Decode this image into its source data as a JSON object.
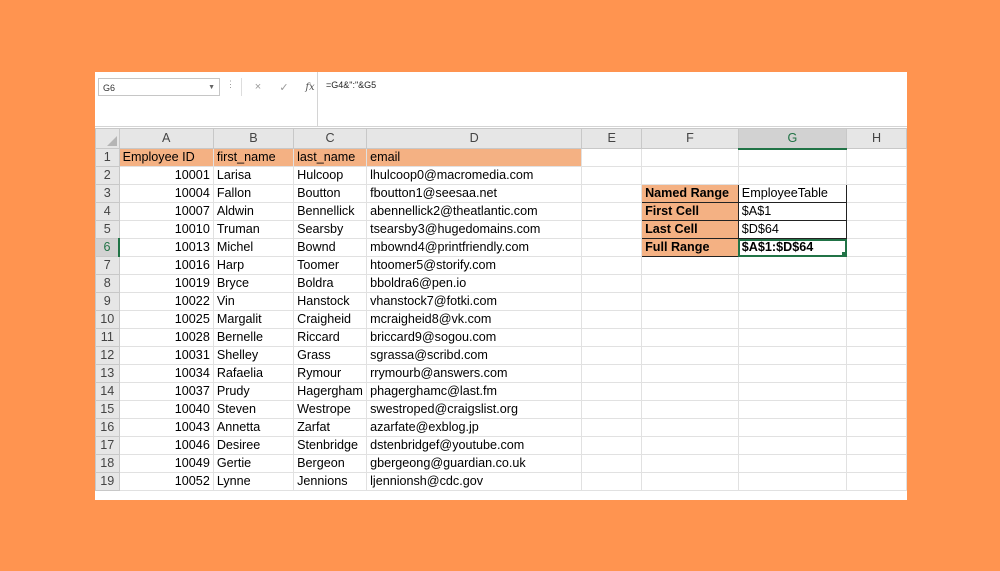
{
  "formula_bar": {
    "name_box": "G6",
    "cancel_icon": "×",
    "enter_icon": "✓",
    "fx_label": "fx",
    "formula": "=G4&\":\"&G5"
  },
  "columns": [
    "A",
    "B",
    "C",
    "D",
    "E",
    "F",
    "G",
    "H"
  ],
  "headers": [
    "Employee ID",
    "first_name",
    "last_name",
    "email"
  ],
  "rows": [
    {
      "n": "1"
    },
    {
      "n": "2",
      "id": "10001",
      "first": "Larisa",
      "last": "Hulcoop",
      "email": "lhulcoop0@macromedia.com"
    },
    {
      "n": "3",
      "id": "10004",
      "first": "Fallon",
      "last": "Boutton",
      "email": "fboutton1@seesaa.net"
    },
    {
      "n": "4",
      "id": "10007",
      "first": "Aldwin",
      "last": "Bennellick",
      "email": "abennellick2@theatlantic.com"
    },
    {
      "n": "5",
      "id": "10010",
      "first": "Truman",
      "last": "Searsby",
      "email": "tsearsby3@hugedomains.com"
    },
    {
      "n": "6",
      "id": "10013",
      "first": "Michel",
      "last": "Bownd",
      "email": "mbownd4@printfriendly.com"
    },
    {
      "n": "7",
      "id": "10016",
      "first": "Harp",
      "last": "Toomer",
      "email": "htoomer5@storify.com"
    },
    {
      "n": "8",
      "id": "10019",
      "first": "Bryce",
      "last": "Boldra",
      "email": "bboldra6@pen.io"
    },
    {
      "n": "9",
      "id": "10022",
      "first": "Vin",
      "last": "Hanstock",
      "email": "vhanstock7@fotki.com"
    },
    {
      "n": "10",
      "id": "10025",
      "first": "Margalit",
      "last": "Craigheid",
      "email": "mcraigheid8@vk.com"
    },
    {
      "n": "11",
      "id": "10028",
      "first": "Bernelle",
      "last": "Riccard",
      "email": "briccard9@sogou.com"
    },
    {
      "n": "12",
      "id": "10031",
      "first": "Shelley",
      "last": "Grass",
      "email": "sgrassa@scribd.com"
    },
    {
      "n": "13",
      "id": "10034",
      "first": "Rafaelia",
      "last": "Rymour",
      "email": "rrymourb@answers.com"
    },
    {
      "n": "14",
      "id": "10037",
      "first": "Prudy",
      "last": "Hagergham",
      "email": "phagerghamc@last.fm"
    },
    {
      "n": "15",
      "id": "10040",
      "first": "Steven",
      "last": "Westrope",
      "email": "swestroped@craigslist.org"
    },
    {
      "n": "16",
      "id": "10043",
      "first": "Annetta",
      "last": "Zarfat",
      "email": "azarfate@exblog.jp"
    },
    {
      "n": "17",
      "id": "10046",
      "first": "Desiree",
      "last": "Stenbridge",
      "email": "dstenbridgef@youtube.com"
    },
    {
      "n": "18",
      "id": "10049",
      "first": "Gertie",
      "last": "Bergeon",
      "email": "gbergeong@guardian.co.uk"
    },
    {
      "n": "19",
      "id": "10052",
      "first": "Lynne",
      "last": "Jennions",
      "email": "ljennionsh@cdc.gov"
    }
  ],
  "side_table": {
    "named_range_label": "Named Range",
    "named_range_value": "EmployeeTable",
    "first_cell_label": "First Cell",
    "first_cell_value": "$A$1",
    "last_cell_label": "Last Cell",
    "last_cell_value": "$D$64",
    "full_range_label": "Full Range",
    "full_range_value": "$A$1:$D$64"
  },
  "colors": {
    "background": "#FF9450",
    "header_fill": "#F4B183",
    "selection": "#217346"
  }
}
